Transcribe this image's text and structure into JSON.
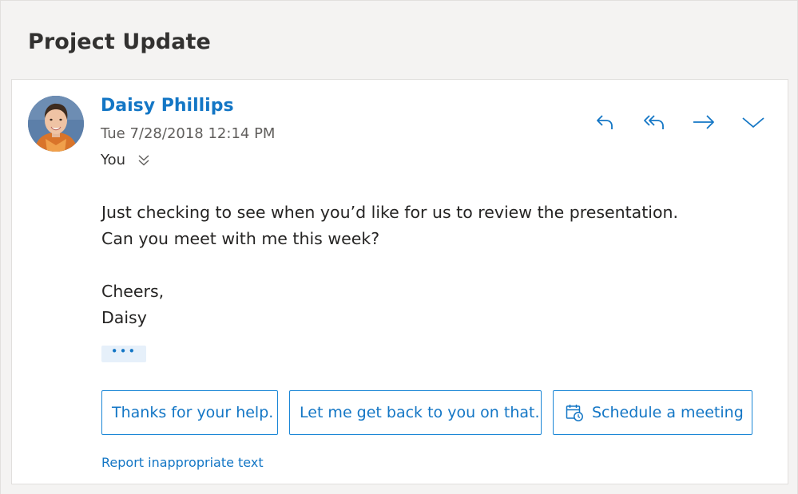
{
  "message": {
    "subject": "Project Update",
    "sender": "Daisy Phillips",
    "date": "Tue 7/28/2018 12:14 PM",
    "recipient": "You",
    "body": {
      "line1": "Just checking to see when you’d like for us to review the presentation.",
      "line2": "Can you meet with me this week?",
      "closing": "Cheers,",
      "signature": "Daisy"
    },
    "ellipsis": "•••"
  },
  "actions": {
    "icons": [
      "reply-icon",
      "reply-all-icon",
      "forward-icon",
      "more-actions-chevron-icon"
    ]
  },
  "suggested_replies": [
    {
      "label": "Thanks for your help."
    },
    {
      "label": "Let me get back to you on that."
    },
    {
      "label": "Schedule a meeting",
      "icon": "calendar-clock-icon"
    }
  ],
  "footer": {
    "report_link": "Report inappropriate text"
  },
  "colors": {
    "accent": "#1376c5",
    "border": "#1a86d6",
    "background": "#f4f3f2",
    "card": "#ffffff"
  }
}
